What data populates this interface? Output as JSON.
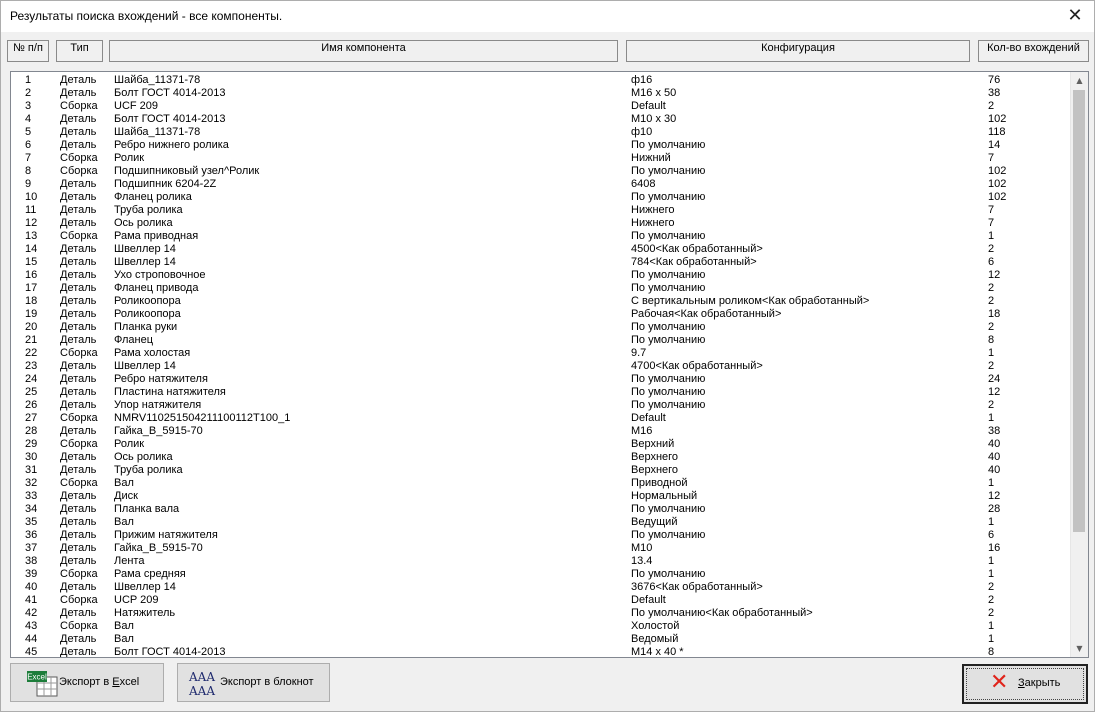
{
  "window": {
    "title": "Результаты поиска вхождений  - все компоненты.",
    "close_glyph": "✕"
  },
  "columns": {
    "num": "№ п/п",
    "type": "Тип",
    "name": "Имя компонента",
    "config": "Конфигурация",
    "count": "Кол-во вхождений"
  },
  "rows": [
    [
      "1",
      "Деталь",
      "Шайба_11371-78",
      "ф16",
      "76"
    ],
    [
      "2",
      "Деталь",
      "Болт ГОСТ 4014-2013",
      "M16 x 50",
      "38"
    ],
    [
      "3",
      "Сборка",
      "UCF 209",
      "Default",
      "2"
    ],
    [
      "4",
      "Деталь",
      "Болт ГОСТ 4014-2013",
      "M10 x 30",
      "102"
    ],
    [
      "5",
      "Деталь",
      "Шайба_11371-78",
      "ф10",
      "118"
    ],
    [
      "6",
      "Деталь",
      "Ребро нижнего ролика",
      "По умолчанию",
      "14"
    ],
    [
      "7",
      "Сборка",
      "Ролик",
      "Нижний",
      "7"
    ],
    [
      "8",
      "Сборка",
      "Подшипниковый узел^Ролик",
      "По умолчанию",
      "102"
    ],
    [
      "9",
      "Деталь",
      "Подшипник 6204-2Z",
      "6408",
      "102"
    ],
    [
      "10",
      "Деталь",
      "Фланец ролика",
      "По умолчанию",
      "102"
    ],
    [
      "11",
      "Деталь",
      "Труба ролика",
      "Нижнего",
      "7"
    ],
    [
      "12",
      "Деталь",
      "Ось ролика",
      "Нижнего",
      "7"
    ],
    [
      "13",
      "Сборка",
      "Рама приводная",
      "По умолчанию",
      "1"
    ],
    [
      "14",
      "Деталь",
      "Швеллер 14",
      "4500<Как обработанный>",
      "2"
    ],
    [
      "15",
      "Деталь",
      "Швеллер 14",
      "784<Как обработанный>",
      "6"
    ],
    [
      "16",
      "Деталь",
      "Ухо строповочное",
      "По умолчанию",
      "12"
    ],
    [
      "17",
      "Деталь",
      "Фланец привода",
      "По умолчанию",
      "2"
    ],
    [
      "18",
      "Деталь",
      "Роликоопора",
      "С вертикальным роликом<Как обработанный>",
      "2"
    ],
    [
      "19",
      "Деталь",
      "Роликоопора",
      "Рабочая<Как обработанный>",
      "18"
    ],
    [
      "20",
      "Деталь",
      "Планка руки",
      "По умолчанию",
      "2"
    ],
    [
      "21",
      "Деталь",
      "Фланец",
      "По умолчанию",
      "8"
    ],
    [
      "22",
      "Сборка",
      "Рама холостая",
      "9.7",
      "1"
    ],
    [
      "23",
      "Деталь",
      "Швеллер 14",
      "4700<Как обработанный>",
      "2"
    ],
    [
      "24",
      "Деталь",
      "Ребро натяжителя",
      "По умолчанию",
      "24"
    ],
    [
      "25",
      "Деталь",
      "Пластина натяжителя",
      "По умолчанию",
      "12"
    ],
    [
      "26",
      "Деталь",
      "Упор натяжителя",
      "По умолчанию",
      "2"
    ],
    [
      "27",
      "Сборка",
      "NMRV110251504211100112T100_1",
      "Default",
      "1"
    ],
    [
      "28",
      "Деталь",
      "Гайка_В_5915-70",
      "M16",
      "38"
    ],
    [
      "29",
      "Сборка",
      "Ролик",
      "Верхний",
      "40"
    ],
    [
      "30",
      "Деталь",
      "Ось ролика",
      "Верхнего",
      "40"
    ],
    [
      "31",
      "Деталь",
      "Труба ролика",
      "Верхнего",
      "40"
    ],
    [
      "32",
      "Сборка",
      "Вал",
      "Приводной",
      "1"
    ],
    [
      "33",
      "Деталь",
      "Диск",
      "Нормальный",
      "12"
    ],
    [
      "34",
      "Деталь",
      "Планка вала",
      "По умолчанию",
      "28"
    ],
    [
      "35",
      "Деталь",
      "Вал",
      "Ведущий",
      "1"
    ],
    [
      "36",
      "Деталь",
      "Прижим натяжителя",
      "По умолчанию",
      "6"
    ],
    [
      "37",
      "Деталь",
      "Гайка_В_5915-70",
      "M10",
      "16"
    ],
    [
      "38",
      "Деталь",
      "Лента",
      "13.4",
      "1"
    ],
    [
      "39",
      "Сборка",
      "Рама средняя",
      "По умолчанию",
      "1"
    ],
    [
      "40",
      "Деталь",
      "Швеллер 14",
      "3676<Как обработанный>",
      "2"
    ],
    [
      "41",
      "Сборка",
      "UCP 209",
      "Default",
      "2"
    ],
    [
      "42",
      "Деталь",
      "Натяжитель",
      "По умолчанию<Как обработанный>",
      "2"
    ],
    [
      "43",
      "Сборка",
      "Вал",
      "Холостой",
      "1"
    ],
    [
      "44",
      "Деталь",
      "Вал",
      "Ведомый",
      "1"
    ],
    [
      "45",
      "Деталь",
      "Болт ГОСТ 4014-2013",
      "M14 x 40 *",
      "8"
    ]
  ],
  "buttons": {
    "excel_before": "Экспорт в ",
    "excel_underlined": "E",
    "excel_after": "xcel",
    "excel_icon_text": "Excel",
    "notepad_label": "Экспорт в блокнот",
    "notepad_icon_text": "AAA",
    "close_underlined": "З",
    "close_after": "акрыть",
    "close_icon": "✕"
  },
  "colors": {
    "close_icon": "#e0241b",
    "excel_green": "#1d7d3a",
    "notepad_blue": "#1f2a6e"
  }
}
